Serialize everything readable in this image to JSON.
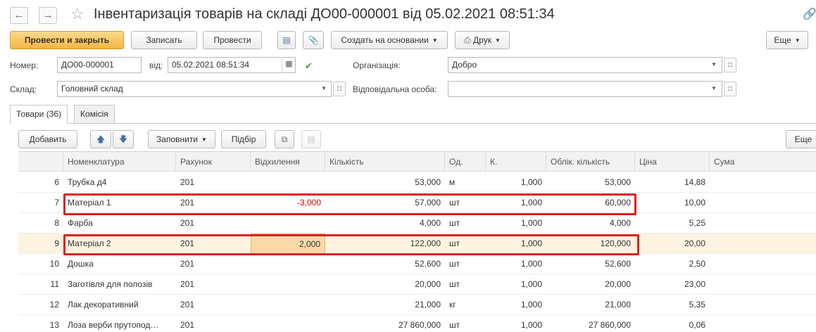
{
  "header": {
    "back_icon": "arrow-left-icon",
    "forward_icon": "arrow-right-icon",
    "title": "Інвентаризація товарів на складі ДО00-000001 від 05.02.2021 08:51:34"
  },
  "toolbar": {
    "post_close": "Провести и закрыть",
    "save": "Записать",
    "post": "Провести",
    "create_based": "Создать на основании",
    "print": "Друк",
    "more": "Еще"
  },
  "form": {
    "number_label": "Номер:",
    "number_value": "ДО00-000001",
    "date_label": "від:",
    "date_value": "05.02.2021 08:51:34",
    "org_label": "Організація:",
    "org_value": "Добро",
    "warehouse_label": "Склад:",
    "warehouse_value": "Головний склад",
    "responsible_label": "Відповідальна особа:",
    "responsible_value": ""
  },
  "tabs": [
    {
      "label": "Товари (36)",
      "active": true
    },
    {
      "label": "Комісія",
      "active": false
    }
  ],
  "table_toolbar": {
    "add": "Добавить",
    "fill": "Заповнити",
    "select": "Підбір",
    "more": "Еще"
  },
  "table": {
    "columns": [
      "Номенклатура",
      "Рахунок",
      "Відхилення",
      "Кількість",
      "Од.",
      "К.",
      "Облік. кількість",
      "Ціна",
      "Сума"
    ],
    "rows": [
      {
        "n": "6",
        "item": "Трубка д4",
        "account": "201",
        "deviation": "",
        "qty": "53,000",
        "unit": "м",
        "k": "1,000",
        "acc_qty": "53,000",
        "price": "14,88",
        "sum": ""
      },
      {
        "n": "7",
        "item": "Матеріал 1",
        "account": "201",
        "deviation": "-3,000",
        "qty": "57,000",
        "unit": "шт",
        "k": "1,000",
        "acc_qty": "60,000",
        "price": "10,00",
        "sum": ""
      },
      {
        "n": "8",
        "item": "Фарба",
        "account": "201",
        "deviation": "",
        "qty": "4,000",
        "unit": "шт",
        "k": "1,000",
        "acc_qty": "4,000",
        "price": "5,25",
        "sum": ""
      },
      {
        "n": "9",
        "item": "Матеріал 2",
        "account": "201",
        "deviation": "2,000",
        "qty": "122,000",
        "unit": "шт",
        "k": "1,000",
        "acc_qty": "120,000",
        "price": "20,00",
        "sum": ""
      },
      {
        "n": "10",
        "item": "Дошка",
        "account": "201",
        "deviation": "",
        "qty": "52,600",
        "unit": "шт",
        "k": "1,000",
        "acc_qty": "52,600",
        "price": "2,50",
        "sum": ""
      },
      {
        "n": "11",
        "item": "Заготівля для полозів",
        "account": "201",
        "deviation": "",
        "qty": "20,000",
        "unit": "шт",
        "k": "1,000",
        "acc_qty": "20,000",
        "price": "23,00",
        "sum": ""
      },
      {
        "n": "12",
        "item": "Лак декоративний",
        "account": "201",
        "deviation": "",
        "qty": "21,000",
        "unit": "кг",
        "k": "1,000",
        "acc_qty": "21,000",
        "price": "5,35",
        "sum": ""
      },
      {
        "n": "13",
        "item": "Лоза верби прутопод…",
        "account": "201",
        "deviation": "",
        "qty": "27 860,000",
        "unit": "шт",
        "k": "1,000",
        "acc_qty": "27 860,000",
        "price": "0,06",
        "sum": ""
      }
    ]
  },
  "colors": {
    "primary_button": "#f3b542",
    "selected_row": "#fdf3e0",
    "negative": "#d00000",
    "highlight_border": "#e02020"
  }
}
